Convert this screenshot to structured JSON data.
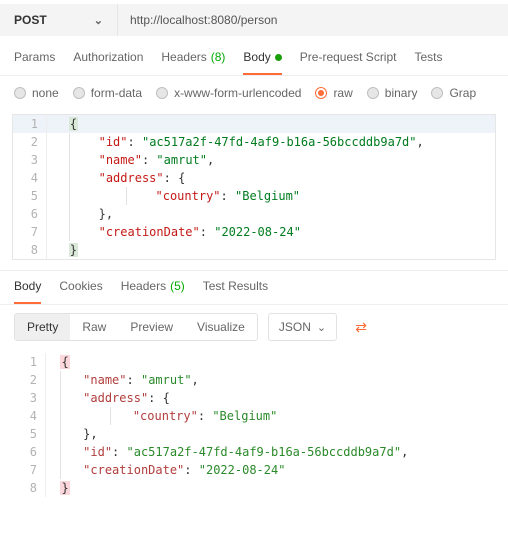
{
  "request": {
    "method": "POST",
    "url": "http://localhost:8080/person",
    "tabs": {
      "params": "Params",
      "auth": "Authorization",
      "headers_label": "Headers",
      "headers_count": "(8)",
      "body": "Body",
      "prereq": "Pre-request Script",
      "tests": "Tests"
    },
    "body_types": {
      "none": "none",
      "form_data": "form-data",
      "xwww": "x-www-form-urlencoded",
      "raw": "raw",
      "binary": "binary",
      "graphql": "Grap"
    },
    "body_json": {
      "id": "ac517a2f-47fd-4af9-b16a-56bccddb9a7d",
      "name": "amrut",
      "address": {
        "country": "Belgium"
      },
      "creationDate": "2022-08-24"
    }
  },
  "response": {
    "tabs": {
      "body": "Body",
      "cookies": "Cookies",
      "headers_label": "Headers",
      "headers_count": "(5)",
      "test_results": "Test Results"
    },
    "views": {
      "pretty": "Pretty",
      "raw": "Raw",
      "preview": "Preview",
      "visualize": "Visualize"
    },
    "format_dd": "JSON",
    "body_json": {
      "name": "amrut",
      "address": {
        "country": "Belgium"
      },
      "id": "ac517a2f-47fd-4af9-b16a-56bccddb9a7d",
      "creationDate": "2022-08-24"
    }
  }
}
